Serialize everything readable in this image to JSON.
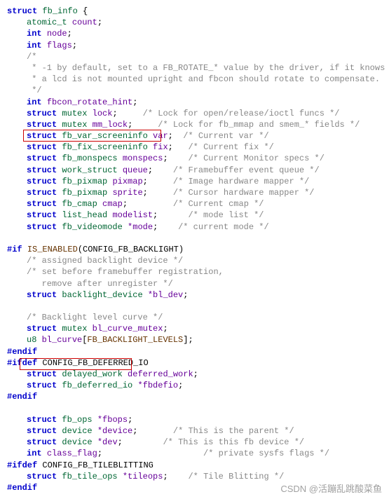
{
  "code": {
    "l1_kw": "struct",
    "l1_ty": "fb_info",
    "l1_b": " {",
    "l2_ty": "atomic_t",
    "l2_id": "count",
    "l2_sc": ";",
    "l3_kw": "int",
    "l3_id": "node",
    "l3_sc": ";",
    "l4_kw": "int",
    "l4_id": "flags",
    "l4_sc": ";",
    "l5": "/*",
    "l6": " * -1 by default, set to a FB_ROTATE_* value by the driver, if it knows",
    "l7": " * a lcd is not mounted upright and fbcon should rotate to compensate.",
    "l8": " */",
    "l9_kw": "int",
    "l9_id": "fbcon_rotate_hint",
    "l9_sc": ";",
    "l10_kw": "struct",
    "l10_ty": "mutex",
    "l10_id": "lock",
    "l10_sc": ";",
    "l10_c": "     /* Lock for open/release/ioctl funcs */",
    "l11_kw": "struct",
    "l11_ty": "mutex",
    "l11_id": "mm_lock",
    "l11_sc": ";",
    "l11_c": "     /* Lock for fb_mmap and smem_* fields */",
    "l12_kw": "struct",
    "l12_ty": "fb_var_screeninfo",
    "l12_id": "var",
    "l12_sc": ";",
    "l12_c": "  /* Current var */",
    "l13_kw": "struct",
    "l13_ty": "fb_fix_screeninfo",
    "l13_id": "fix",
    "l13_sc": ";",
    "l13_c": "   /* Current fix */",
    "l14_kw": "struct",
    "l14_ty": "fb_monspecs",
    "l14_id": "monspecs",
    "l14_sc": ";",
    "l14_c": "    /* Current Monitor specs */",
    "l15_kw": "struct",
    "l15_ty": "work_struct",
    "l15_id": "queue",
    "l15_sc": ";",
    "l15_c": "    /* Framebuffer event queue */",
    "l16_kw": "struct",
    "l16_ty": "fb_pixmap",
    "l16_id": "pixmap",
    "l16_sc": ";",
    "l16_c": "     /* Image hardware mapper */",
    "l17_kw": "struct",
    "l17_ty": "fb_pixmap",
    "l17_id": "sprite",
    "l17_sc": ";",
    "l17_c": "     /* Cursor hardware mapper */",
    "l18_kw": "struct",
    "l18_ty": "fb_cmap",
    "l18_id": "cmap",
    "l18_sc": ";",
    "l18_c": "         /* Current cmap */",
    "l19_kw": "struct",
    "l19_ty": "list_head",
    "l19_id": "modelist",
    "l19_sc": ";",
    "l19_c": "      /* mode list */",
    "l20_kw": "struct",
    "l20_ty": "fb_videomode",
    "l20_id": "*mode",
    "l20_sc": ";",
    "l20_c": "    /* current mode */",
    "l21_a": "#if ",
    "l21_m": "IS_ENABLED",
    "l21_b": "(CONFIG_FB_BACKLIGHT)",
    "l22": "/* assigned backlight device */",
    "l23": "/* set before framebuffer registration,",
    "l24": "   remove after unregister */",
    "l25_kw": "struct",
    "l25_ty": "backlight_device",
    "l25_id": "*bl_dev",
    "l25_sc": ";",
    "l26": "/* Backlight level curve */",
    "l27_kw": "struct",
    "l27_ty": "mutex",
    "l27_id": "bl_curve_mutex",
    "l27_sc": ";",
    "l28_ty": "u8",
    "l28_id": "bl_curve",
    "l28_op": "[",
    "l28_m": "FB_BACKLIGHT_LEVELS",
    "l28_cl": "];",
    "l29": "#endif",
    "l30": "#ifdef",
    "l30b": " CONFIG_FB_DEFERRED_IO",
    "l31_kw": "struct",
    "l31_ty": "delayed_work",
    "l31_id": "deferred_work",
    "l31_sc": ";",
    "l32_kw": "struct",
    "l32_ty": "fb_deferred_io",
    "l32_id": "*fbdefio",
    "l32_sc": ";",
    "l33": "#endif",
    "l34_kw": "struct",
    "l34_ty": "fb_ops",
    "l34_id": "*fbops",
    "l34_sc": ";",
    "l35_kw": "struct",
    "l35_ty": "device",
    "l35_id": "*device",
    "l35_sc": ";",
    "l35_c": "       /* This is the parent */",
    "l36_kw": "struct",
    "l36_ty": "device",
    "l36_id": "*dev",
    "l36_sc": ";",
    "l36_c": "        /* This is this fb device */",
    "l37_kw": "int",
    "l37_id": "class_flag",
    "l37_sc": ";",
    "l37_c": "                    /* private sysfs flags */",
    "l38": "#ifdef",
    "l38b": " CONFIG_FB_TILEBLITTING",
    "l39_kw": "struct",
    "l39_ty": "fb_tile_ops",
    "l39_id": "*tileops",
    "l39_sc": ";",
    "l39_c": "    /* Tile Blitting */",
    "l40": "#endif"
  },
  "watermark": "CSDN @活蹦乱跳酸菜鱼"
}
